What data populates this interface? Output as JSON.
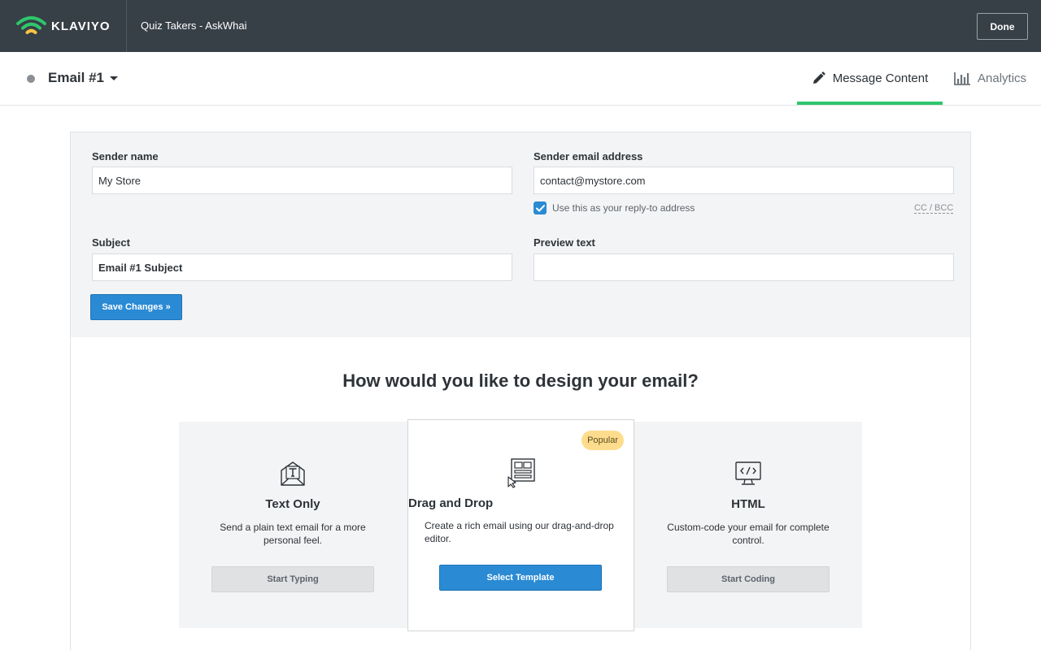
{
  "topbar": {
    "logo_text": "KLAVIYO",
    "flow_title": "Quiz Takers - AskWhai",
    "done_label": "Done"
  },
  "subheader": {
    "email_name": "Email #1",
    "tabs": [
      {
        "label": "Message Content",
        "icon": "pencil-icon",
        "active": true
      },
      {
        "label": "Analytics",
        "icon": "bar-chart-icon",
        "active": false
      }
    ]
  },
  "form": {
    "sender_name": {
      "label": "Sender name",
      "value": "My Store"
    },
    "sender_email": {
      "label": "Sender email address",
      "value": "contact@mystore.com"
    },
    "reply_to": {
      "label": "Use this as your reply-to address",
      "checked": true
    },
    "cc_bcc_label": "CC / BCC",
    "subject": {
      "label": "Subject",
      "value": "Email #1 Subject"
    },
    "preview_text": {
      "label": "Preview text",
      "value": ""
    },
    "save_label": "Save Changes »"
  },
  "design": {
    "title": "How would you like to design your email?",
    "options": [
      {
        "title": "Text Only",
        "description": "Send a plain text email for a more personal feel.",
        "button": "Start Typing",
        "icon": "envelope-text-icon"
      },
      {
        "title": "Drag and Drop",
        "description": "Create a rich email using our drag-and-drop editor.",
        "button": "Select Template",
        "icon": "drag-drop-layout-icon",
        "badge": "Popular"
      },
      {
        "title": "HTML",
        "description": "Custom-code your email for complete control.",
        "button": "Start Coding",
        "icon": "code-monitor-icon"
      }
    ]
  },
  "colors": {
    "topbar": "#373f47",
    "accent_green": "#2ec66b",
    "primary_blue": "#2a8ad4",
    "badge_yellow": "#fddd8d"
  }
}
